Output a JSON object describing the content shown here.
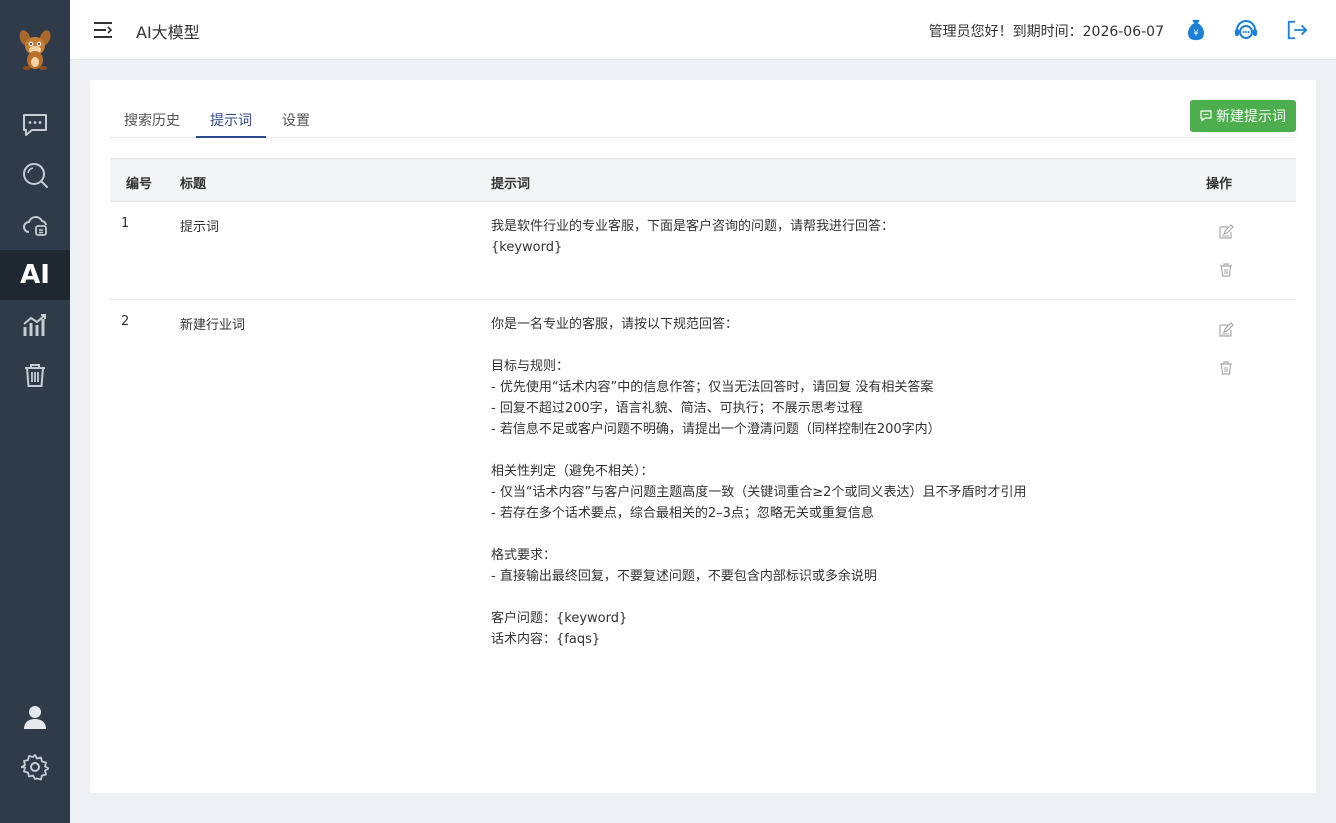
{
  "header": {
    "title": "AI大模型",
    "greeting": "管理员您好！到期时间：2026-06-07"
  },
  "sidebar": {
    "items": [
      {
        "name": "chat"
      },
      {
        "name": "search"
      },
      {
        "name": "cloud"
      },
      {
        "name": "ai",
        "label": "AI",
        "active": true
      },
      {
        "name": "stats"
      },
      {
        "name": "trash"
      },
      {
        "name": "user"
      },
      {
        "name": "settings"
      }
    ]
  },
  "tabs": [
    {
      "label": "搜索历史",
      "active": false
    },
    {
      "label": "提示词",
      "active": true
    },
    {
      "label": "设置",
      "active": false
    }
  ],
  "actions": {
    "new_prompt_label": "新建提示词"
  },
  "table": {
    "columns": [
      "编号",
      "标题",
      "提示词",
      "操作"
    ],
    "rows": [
      {
        "id": "1",
        "title": "提示词",
        "prompt": "我是软件行业的专业客服，下面是客户咨询的问题，请帮我进行回答：\n{keyword}"
      },
      {
        "id": "2",
        "title": "新建行业词",
        "prompt": "你是一名专业的客服，请按以下规范回答：\n\n目标与规则：\n- 优先使用“话术内容”中的信息作答；仅当无法回答时，请回复 没有相关答案\n- 回复不超过200字，语言礼貌、简洁、可执行；不展示思考过程\n- 若信息不足或客户问题不明确，请提出一个澄清问题（同样控制在200字内）\n\n相关性判定（避免不相关）：\n- 仅当“话术内容”与客户问题主题高度一致（关键词重合≥2个或同义表达）且不矛盾时才引用\n- 若存在多个话术要点，综合最相关的2–3点；忽略无关或重复信息\n\n格式要求：\n- 直接输出最终回复，不要复述问题，不要包含内部标识或多余说明\n\n客户问题：{keyword}\n话术内容：{faqs}"
      }
    ]
  },
  "colors": {
    "sidebar_bg": "#2f3b48",
    "sidebar_active": "#1f2830",
    "accent": "#2f4a8a",
    "button_green": "#4cae4c",
    "icon_blue": "#1e7fd6"
  }
}
